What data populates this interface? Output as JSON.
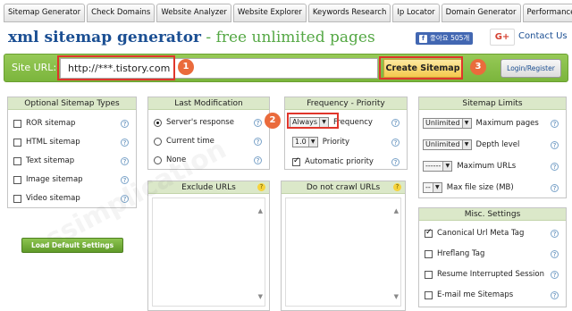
{
  "tabs": [
    "Sitemap Generator",
    "Check Domains",
    "Website Analyzer",
    "Website Explorer",
    "Keywords Research",
    "Ip Locator",
    "Domain Generator",
    "Performance Test"
  ],
  "header": {
    "title_main": "xml sitemap generator",
    "title_dash": " - ",
    "title_free": "free unlimited pages",
    "fb_label": "좋아요 505개",
    "gplus_label": "G+",
    "contact": "Contact Us"
  },
  "urlbar": {
    "label": "Site URL:",
    "url_value": "http://***.tistory.com",
    "create_button": "Create Sitemap",
    "login_button": "Login/Register"
  },
  "annotations": [
    "1",
    "2",
    "3"
  ],
  "optional_types": {
    "title": "Optional Sitemap Types",
    "items": [
      {
        "label": "ROR sitemap",
        "checked": false
      },
      {
        "label": "HTML sitemap",
        "checked": false
      },
      {
        "label": "Text sitemap",
        "checked": false
      },
      {
        "label": "Image sitemap",
        "checked": false
      },
      {
        "label": "Video sitemap",
        "checked": false
      }
    ]
  },
  "last_modification": {
    "title": "Last Modification",
    "items": [
      {
        "label": "Server's response",
        "selected": true
      },
      {
        "label": "Current time",
        "selected": false
      },
      {
        "label": "None",
        "selected": false
      }
    ]
  },
  "frequency_priority": {
    "title": "Frequency - Priority",
    "frequency_value": "Always",
    "frequency_label": "Frequency",
    "priority_value": "1.0",
    "priority_label": "Priority",
    "auto_priority_label": "Automatic priority",
    "auto_priority_checked": true
  },
  "sitemap_limits": {
    "title": "Sitemap Limits",
    "items": [
      {
        "value": "Unlimited",
        "label": "Maximum pages"
      },
      {
        "value": "Unlimited",
        "label": "Depth level"
      },
      {
        "value": "------",
        "label": "Maximum URLs"
      },
      {
        "value": "--",
        "label": "Max file size (MB)"
      }
    ]
  },
  "exclude_urls": {
    "title": "Exclude URLs"
  },
  "do_not_crawl": {
    "title": "Do not crawl URLs"
  },
  "misc_settings": {
    "title": "Misc. Settings",
    "items": [
      {
        "label": "Canonical Url Meta Tag",
        "checked": true
      },
      {
        "label": "Hreflang Tag",
        "checked": false
      },
      {
        "label": "Resume Interrupted Session",
        "checked": false
      },
      {
        "label": "E-mail me Sitemaps",
        "checked": false
      }
    ]
  },
  "load_defaults": "Load Default Settings",
  "watermark": "ssimplication",
  "colors": {
    "brand_green": "#7bb53c",
    "title_blue": "#1b4f93",
    "title_green": "#55a845",
    "annotation_red": "#e0352b",
    "badge_orange": "#ea6b3c"
  }
}
